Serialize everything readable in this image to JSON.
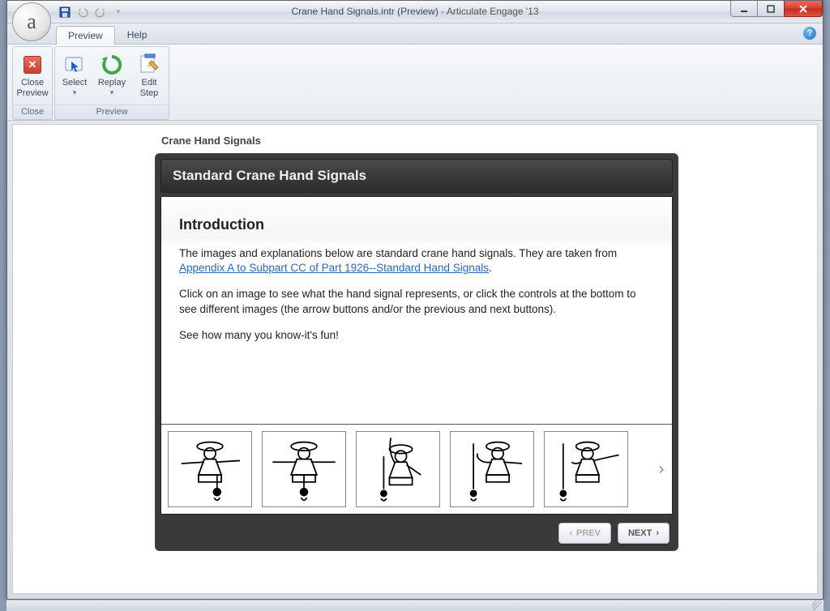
{
  "window": {
    "title_doc": "Crane Hand Signals.intr (Preview)",
    "title_sep": " - ",
    "title_app": "Articulate Engage '13"
  },
  "qat": {
    "save": "save-icon",
    "undo": "undo-icon",
    "redo": "redo-icon"
  },
  "tabs": {
    "preview": "Preview",
    "help": "Help"
  },
  "ribbon": {
    "close": {
      "line1": "Close",
      "line2": "Preview",
      "group": "Close"
    },
    "select": {
      "label": "Select",
      "dd": "▾"
    },
    "replay": {
      "label": "Replay",
      "dd": "▾"
    },
    "edit": {
      "line1": "Edit",
      "line2": "Step"
    },
    "preview_group": "Preview"
  },
  "stage": {
    "title": "Crane Hand Signals",
    "player_title": "Standard Crane Hand Signals",
    "intro_heading": "Introduction",
    "p1a": "The images and explanations below are standard crane hand signals. They are taken from ",
    "p1_link": "Appendix A to Subpart CC of Part 1926--Standard Hand Signals",
    "p1b": ".",
    "p2": "Click on an image to see what the hand signal represents, or click the controls at the bottom to see different images (the arrow buttons and/or the previous and next buttons).",
    "p3": "See how many you know-it's fun!"
  },
  "nav": {
    "prev": "PREV",
    "next": "NEXT"
  },
  "thumb_names": [
    "signal-1",
    "signal-2",
    "signal-3",
    "signal-4",
    "signal-5"
  ]
}
